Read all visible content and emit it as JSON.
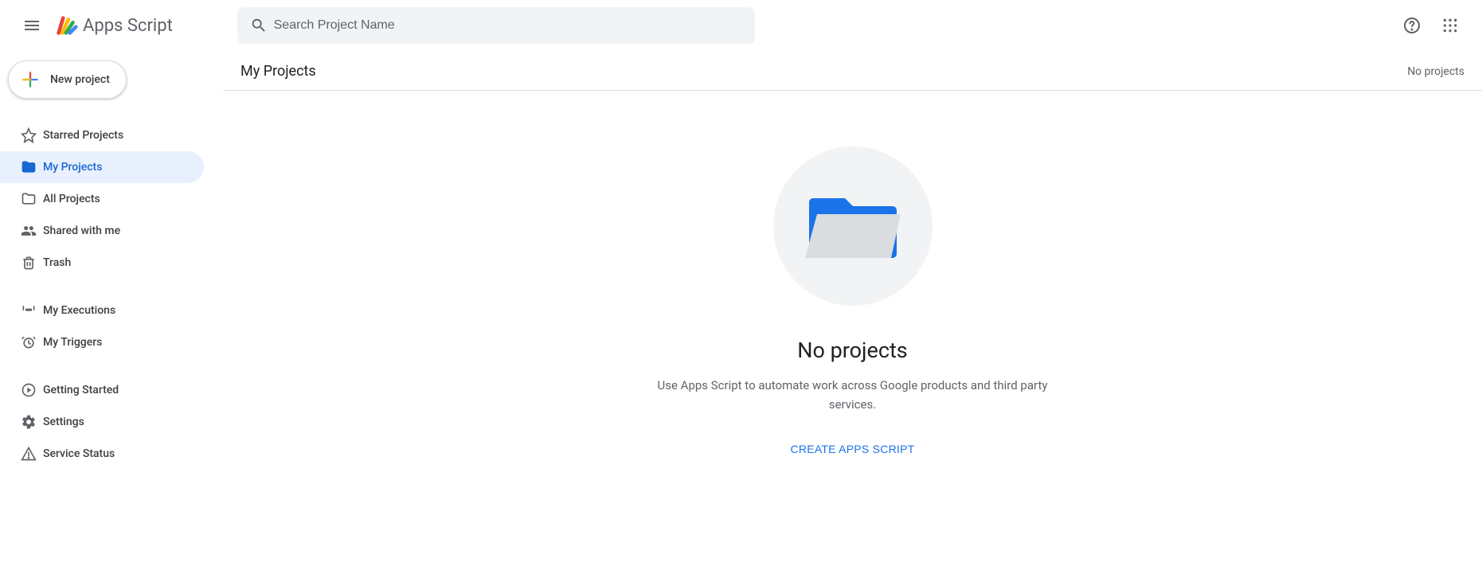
{
  "header": {
    "productName": "Apps Script",
    "searchPlaceholder": "Search Project Name"
  },
  "newProjectLabel": "New project",
  "nav": {
    "group1": [
      {
        "label": "Starred Projects",
        "icon": "star-icon",
        "active": false
      },
      {
        "label": "My Projects",
        "icon": "folder-icon",
        "active": true
      },
      {
        "label": "All Projects",
        "icon": "folder-outline-icon",
        "active": false
      },
      {
        "label": "Shared with me",
        "icon": "people-icon",
        "active": false
      },
      {
        "label": "Trash",
        "icon": "trash-icon",
        "active": false
      }
    ],
    "group2": [
      {
        "label": "My Executions",
        "icon": "executions-icon",
        "active": false
      },
      {
        "label": "My Triggers",
        "icon": "alarm-icon",
        "active": false
      }
    ],
    "group3": [
      {
        "label": "Getting Started",
        "icon": "play-circle-icon",
        "active": false
      },
      {
        "label": "Settings",
        "icon": "gear-icon",
        "active": false
      },
      {
        "label": "Service Status",
        "icon": "warning-icon",
        "active": false
      }
    ]
  },
  "page": {
    "title": "My Projects",
    "countHint": "No projects",
    "emptyTitle": "No projects",
    "emptySub": "Use Apps Script to automate work across Google products and third party services.",
    "createLabel": "CREATE APPS SCRIPT"
  }
}
